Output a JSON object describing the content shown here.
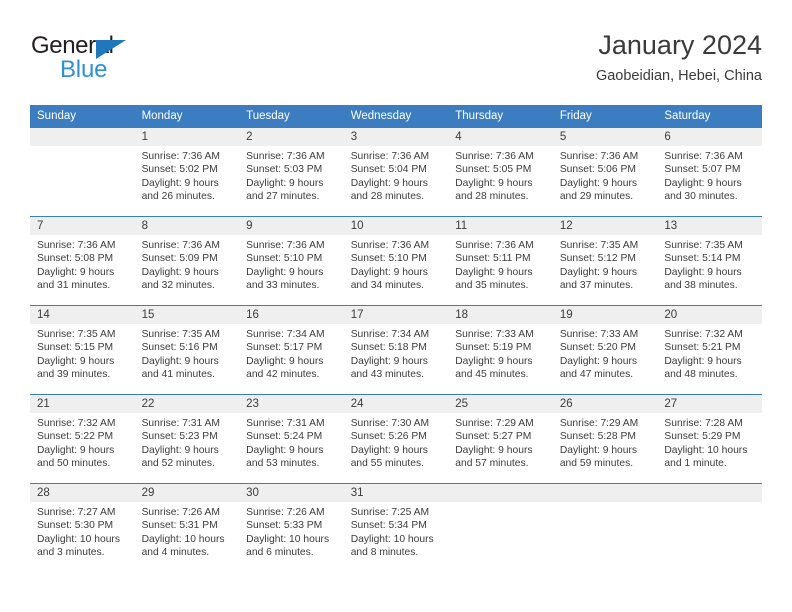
{
  "logo": {
    "word_one": "General",
    "word_two": "Blue",
    "triangle_icon": "triangle-icon",
    "colors": {
      "dark": "#231f20",
      "blue": "#2f90d6",
      "triangle": "#1f77bc"
    }
  },
  "header": {
    "title": "January 2024",
    "subtitle": "Gaobeidian, Hebei, China"
  },
  "theme": {
    "header_blue": "#3b7dc0",
    "daynum_band": "#efefef",
    "text": "#3c3c3c"
  },
  "weekday_headers": [
    "Sunday",
    "Monday",
    "Tuesday",
    "Wednesday",
    "Thursday",
    "Friday",
    "Saturday"
  ],
  "labels": {
    "sunrise": "Sunrise:",
    "sunset": "Sunset:",
    "daylight": "Daylight:"
  },
  "weeks": [
    [
      {
        "day": "",
        "sunrise": "",
        "sunset": "",
        "daylight": "",
        "empty": true
      },
      {
        "day": "1",
        "sunrise": "Sunrise: 7:36 AM",
        "sunset": "Sunset: 5:02 PM",
        "daylight": "Daylight: 9 hours and 26 minutes."
      },
      {
        "day": "2",
        "sunrise": "Sunrise: 7:36 AM",
        "sunset": "Sunset: 5:03 PM",
        "daylight": "Daylight: 9 hours and 27 minutes."
      },
      {
        "day": "3",
        "sunrise": "Sunrise: 7:36 AM",
        "sunset": "Sunset: 5:04 PM",
        "daylight": "Daylight: 9 hours and 28 minutes."
      },
      {
        "day": "4",
        "sunrise": "Sunrise: 7:36 AM",
        "sunset": "Sunset: 5:05 PM",
        "daylight": "Daylight: 9 hours and 28 minutes."
      },
      {
        "day": "5",
        "sunrise": "Sunrise: 7:36 AM",
        "sunset": "Sunset: 5:06 PM",
        "daylight": "Daylight: 9 hours and 29 minutes."
      },
      {
        "day": "6",
        "sunrise": "Sunrise: 7:36 AM",
        "sunset": "Sunset: 5:07 PM",
        "daylight": "Daylight: 9 hours and 30 minutes."
      }
    ],
    [
      {
        "day": "7",
        "sunrise": "Sunrise: 7:36 AM",
        "sunset": "Sunset: 5:08 PM",
        "daylight": "Daylight: 9 hours and 31 minutes."
      },
      {
        "day": "8",
        "sunrise": "Sunrise: 7:36 AM",
        "sunset": "Sunset: 5:09 PM",
        "daylight": "Daylight: 9 hours and 32 minutes."
      },
      {
        "day": "9",
        "sunrise": "Sunrise: 7:36 AM",
        "sunset": "Sunset: 5:10 PM",
        "daylight": "Daylight: 9 hours and 33 minutes."
      },
      {
        "day": "10",
        "sunrise": "Sunrise: 7:36 AM",
        "sunset": "Sunset: 5:10 PM",
        "daylight": "Daylight: 9 hours and 34 minutes."
      },
      {
        "day": "11",
        "sunrise": "Sunrise: 7:36 AM",
        "sunset": "Sunset: 5:11 PM",
        "daylight": "Daylight: 9 hours and 35 minutes."
      },
      {
        "day": "12",
        "sunrise": "Sunrise: 7:35 AM",
        "sunset": "Sunset: 5:12 PM",
        "daylight": "Daylight: 9 hours and 37 minutes."
      },
      {
        "day": "13",
        "sunrise": "Sunrise: 7:35 AM",
        "sunset": "Sunset: 5:14 PM",
        "daylight": "Daylight: 9 hours and 38 minutes."
      }
    ],
    [
      {
        "day": "14",
        "sunrise": "Sunrise: 7:35 AM",
        "sunset": "Sunset: 5:15 PM",
        "daylight": "Daylight: 9 hours and 39 minutes."
      },
      {
        "day": "15",
        "sunrise": "Sunrise: 7:35 AM",
        "sunset": "Sunset: 5:16 PM",
        "daylight": "Daylight: 9 hours and 41 minutes."
      },
      {
        "day": "16",
        "sunrise": "Sunrise: 7:34 AM",
        "sunset": "Sunset: 5:17 PM",
        "daylight": "Daylight: 9 hours and 42 minutes."
      },
      {
        "day": "17",
        "sunrise": "Sunrise: 7:34 AM",
        "sunset": "Sunset: 5:18 PM",
        "daylight": "Daylight: 9 hours and 43 minutes."
      },
      {
        "day": "18",
        "sunrise": "Sunrise: 7:33 AM",
        "sunset": "Sunset: 5:19 PM",
        "daylight": "Daylight: 9 hours and 45 minutes."
      },
      {
        "day": "19",
        "sunrise": "Sunrise: 7:33 AM",
        "sunset": "Sunset: 5:20 PM",
        "daylight": "Daylight: 9 hours and 47 minutes."
      },
      {
        "day": "20",
        "sunrise": "Sunrise: 7:32 AM",
        "sunset": "Sunset: 5:21 PM",
        "daylight": "Daylight: 9 hours and 48 minutes."
      }
    ],
    [
      {
        "day": "21",
        "sunrise": "Sunrise: 7:32 AM",
        "sunset": "Sunset: 5:22 PM",
        "daylight": "Daylight: 9 hours and 50 minutes."
      },
      {
        "day": "22",
        "sunrise": "Sunrise: 7:31 AM",
        "sunset": "Sunset: 5:23 PM",
        "daylight": "Daylight: 9 hours and 52 minutes."
      },
      {
        "day": "23",
        "sunrise": "Sunrise: 7:31 AM",
        "sunset": "Sunset: 5:24 PM",
        "daylight": "Daylight: 9 hours and 53 minutes."
      },
      {
        "day": "24",
        "sunrise": "Sunrise: 7:30 AM",
        "sunset": "Sunset: 5:26 PM",
        "daylight": "Daylight: 9 hours and 55 minutes."
      },
      {
        "day": "25",
        "sunrise": "Sunrise: 7:29 AM",
        "sunset": "Sunset: 5:27 PM",
        "daylight": "Daylight: 9 hours and 57 minutes."
      },
      {
        "day": "26",
        "sunrise": "Sunrise: 7:29 AM",
        "sunset": "Sunset: 5:28 PM",
        "daylight": "Daylight: 9 hours and 59 minutes."
      },
      {
        "day": "27",
        "sunrise": "Sunrise: 7:28 AM",
        "sunset": "Sunset: 5:29 PM",
        "daylight": "Daylight: 10 hours and 1 minute."
      }
    ],
    [
      {
        "day": "28",
        "sunrise": "Sunrise: 7:27 AM",
        "sunset": "Sunset: 5:30 PM",
        "daylight": "Daylight: 10 hours and 3 minutes."
      },
      {
        "day": "29",
        "sunrise": "Sunrise: 7:26 AM",
        "sunset": "Sunset: 5:31 PM",
        "daylight": "Daylight: 10 hours and 4 minutes."
      },
      {
        "day": "30",
        "sunrise": "Sunrise: 7:26 AM",
        "sunset": "Sunset: 5:33 PM",
        "daylight": "Daylight: 10 hours and 6 minutes."
      },
      {
        "day": "31",
        "sunrise": "Sunrise: 7:25 AM",
        "sunset": "Sunset: 5:34 PM",
        "daylight": "Daylight: 10 hours and 8 minutes."
      },
      {
        "day": "",
        "sunrise": "",
        "sunset": "",
        "daylight": "",
        "empty": true
      },
      {
        "day": "",
        "sunrise": "",
        "sunset": "",
        "daylight": "",
        "empty": true
      },
      {
        "day": "",
        "sunrise": "",
        "sunset": "",
        "daylight": "",
        "empty": true
      }
    ]
  ]
}
